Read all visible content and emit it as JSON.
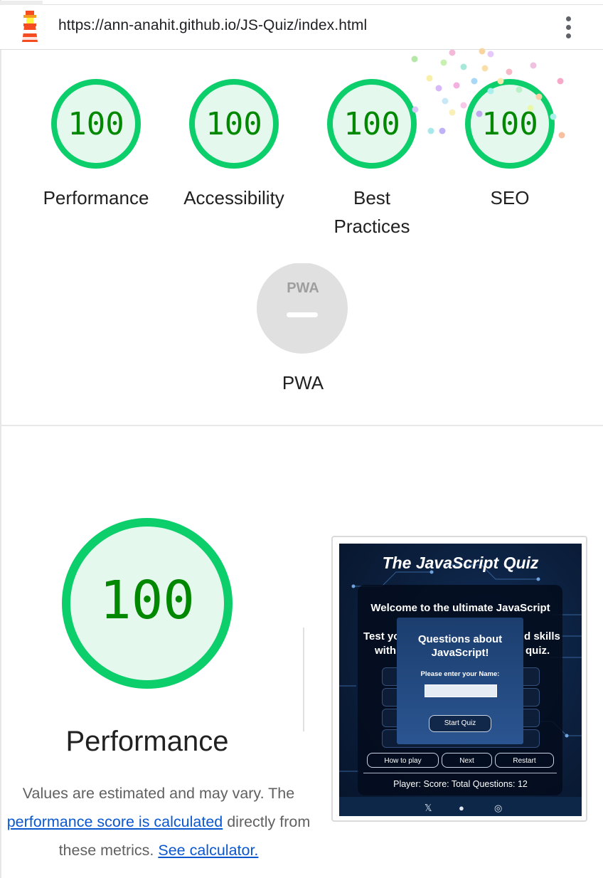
{
  "url": "https://ann-anahit.github.io/JS-Quiz/index.html",
  "icons": {
    "app": "lighthouse-icon",
    "menu": "kebab-menu-icon"
  },
  "colors": {
    "pass": "#0cce6b",
    "pass_fill": "#e5f8ee",
    "pass_text": "#008800",
    "na": "#e0e0e0",
    "link": "#0b57d0"
  },
  "gauges": [
    {
      "score": "100",
      "label": "Performance"
    },
    {
      "score": "100",
      "label": "Accessibility"
    },
    {
      "score": "100",
      "label_1": "Best",
      "label_2": "Practices"
    },
    {
      "score": "100",
      "label": "SEO"
    }
  ],
  "pwa": {
    "badge": "PWA",
    "label": "PWA"
  },
  "performance": {
    "score": "100",
    "title": "Performance",
    "desc_1": "Values are estimated and may vary. The",
    "link_1": "performance score is calculated",
    "desc_2": " directly from",
    "desc_3": "these metrics. ",
    "link_2": "See calculator."
  },
  "screenshot": {
    "title": "The JavaScript Quiz",
    "welcome": "Welcome to the ultimate JavaScript",
    "test_left_1": "Test yo",
    "test_left_2": "with",
    "test_right_1": "d skills",
    "test_right_2": "quiz.",
    "modal_title": "Questions about",
    "modal_title_2": "JavaScript!",
    "name_prompt": "Please enter your Name:",
    "start_button": "Start Quiz",
    "how_to_play": "How to play",
    "next": "Next",
    "restart": "Restart",
    "status": "Player:  Score:  Total Questions: 12",
    "footer_icons": [
      "x-icon",
      "github-icon",
      "instagram-icon"
    ]
  }
}
